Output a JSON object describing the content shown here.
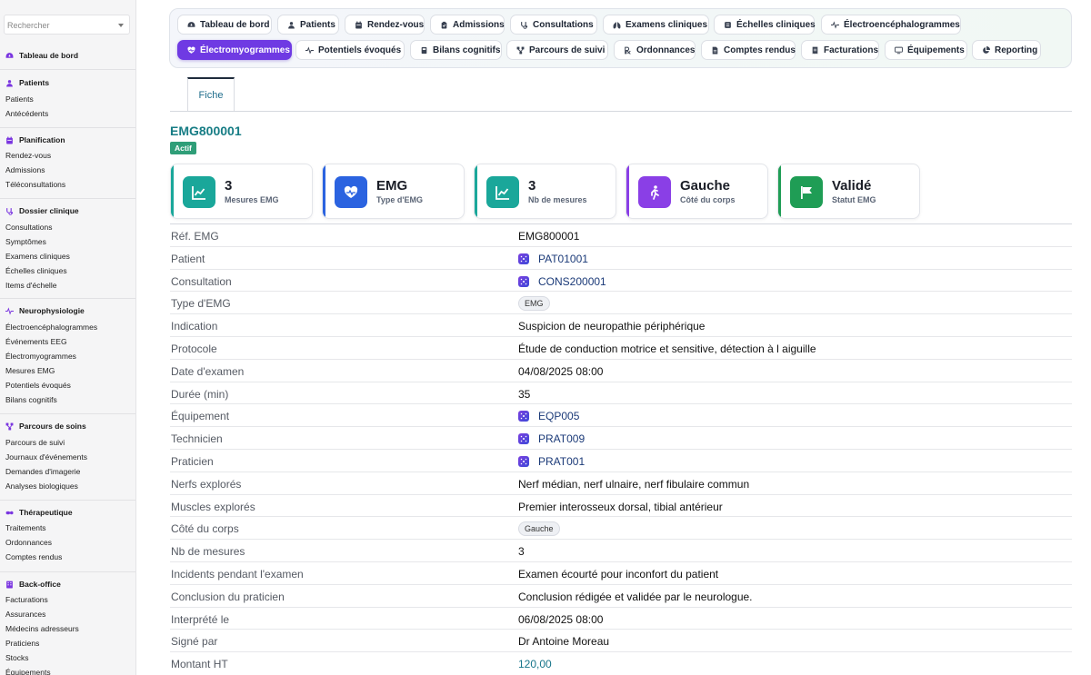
{
  "sidebar": {
    "search_placeholder": "Rechercher",
    "sections": [
      {
        "title": "Tableau de bord",
        "icon": "dashboard-icon",
        "items": []
      },
      {
        "title": "Patients",
        "icon": "user-icon",
        "items": [
          "Patients",
          "Antécédents"
        ]
      },
      {
        "title": "Planification",
        "icon": "calendar-icon",
        "items": [
          "Rendez-vous",
          "Admissions",
          "Téléconsultations"
        ]
      },
      {
        "title": "Dossier clinique",
        "icon": "stethoscope-icon",
        "items": [
          "Consultations",
          "Symptômes",
          "Examens cliniques",
          "Échelles cliniques",
          "Items d'échelle"
        ]
      },
      {
        "title": "Neurophysiologie",
        "icon": "waveform-icon",
        "items": [
          "Électroencéphalogrammes",
          "Événements EEG",
          "Électromyogrammes",
          "Mesures EMG",
          "Potentiels évoqués",
          "Bilans cognitifs"
        ]
      },
      {
        "title": "Parcours de soins",
        "icon": "route-icon",
        "items": [
          "Parcours de suivi",
          "Journaux d'événements",
          "Demandes d'imagerie",
          "Analyses biologiques"
        ]
      },
      {
        "title": "Thérapeutique",
        "icon": "pills-icon",
        "items": [
          "Traitements",
          "Ordonnances",
          "Comptes rendus"
        ]
      },
      {
        "title": "Back-office",
        "icon": "building-icon",
        "items": [
          "Facturations",
          "Assurances",
          "Médecins adresseurs",
          "Praticiens",
          "Stocks",
          "Équipements"
        ]
      }
    ]
  },
  "tabs_row1": [
    {
      "label": "Tableau de bord",
      "icon": "dashboard-icon"
    },
    {
      "label": "Patients",
      "icon": "user-icon"
    },
    {
      "label": "Rendez-vous",
      "icon": "calendar-icon"
    },
    {
      "label": "Admissions",
      "icon": "clipboard-icon"
    },
    {
      "label": "Consultations",
      "icon": "stethoscope-icon"
    },
    {
      "label": "Examens cliniques",
      "icon": "lungs-icon"
    },
    {
      "label": "Échelles cliniques",
      "icon": "scale-icon"
    },
    {
      "label": "Électroencéphalogrammes",
      "icon": "waveform-icon"
    }
  ],
  "tabs_row2": [
    {
      "label": "Électromyogrammes",
      "icon": "heart-pulse-icon",
      "active": true
    },
    {
      "label": "Potentiels évoqués",
      "icon": "waveform-icon"
    },
    {
      "label": "Bilans cognitifs",
      "icon": "book-icon"
    },
    {
      "label": "Parcours de suivi",
      "icon": "route-icon"
    },
    {
      "label": "Ordonnances",
      "icon": "prescription-icon"
    },
    {
      "label": "Comptes rendus",
      "icon": "file-icon"
    },
    {
      "label": "Facturations",
      "icon": "invoice-icon"
    },
    {
      "label": "Équipements",
      "icon": "monitor-icon"
    },
    {
      "label": "Reporting",
      "icon": "pie-chart-icon"
    }
  ],
  "detail_tab": "Fiche",
  "record": {
    "id": "EMG800001",
    "status": "Actif"
  },
  "cards": [
    {
      "value": "3",
      "label": "Mesures EMG",
      "icon": "chart-icon",
      "color": "#1aa79a"
    },
    {
      "value": "EMG",
      "label": "Type d'EMG",
      "icon": "heart-pulse-icon",
      "color": "#2b63e0"
    },
    {
      "value": "3",
      "label": "Nb de mesures",
      "icon": "chart-icon",
      "color": "#1aa79a"
    },
    {
      "value": "Gauche",
      "label": "Côté du corps",
      "icon": "walking-icon",
      "color": "#8a3fe6"
    },
    {
      "value": "Validé",
      "label": "Statut EMG",
      "icon": "flag-icon",
      "color": "#1f9d55"
    }
  ],
  "fields": [
    {
      "label": "Réf. EMG",
      "value": "EMG800001",
      "kind": "text"
    },
    {
      "label": "Patient",
      "value": "PAT01001",
      "kind": "link"
    },
    {
      "label": "Consultation",
      "value": "CONS200001",
      "kind": "link"
    },
    {
      "label": "Type d'EMG",
      "value": "EMG",
      "kind": "pill"
    },
    {
      "label": "Indication",
      "value": "Suspicion de neuropathie périphérique",
      "kind": "text"
    },
    {
      "label": "Protocole",
      "value": "Étude de conduction motrice et sensitive, détection à l aiguille",
      "kind": "text"
    },
    {
      "label": "Date d'examen",
      "value": "04/08/2025 08:00",
      "kind": "text"
    },
    {
      "label": "Durée (min)",
      "value": "35",
      "kind": "text"
    },
    {
      "label": "Équipement",
      "value": "EQP005",
      "kind": "link"
    },
    {
      "label": "Technicien",
      "value": "PRAT009",
      "kind": "link"
    },
    {
      "label": "Praticien",
      "value": "PRAT001",
      "kind": "link"
    },
    {
      "label": "Nerfs explorés",
      "value": "Nerf médian, nerf ulnaire, nerf fibulaire commun",
      "kind": "text"
    },
    {
      "label": "Muscles explorés",
      "value": "Premier interosseux dorsal, tibial antérieur",
      "kind": "text"
    },
    {
      "label": "Côté du corps",
      "value": "Gauche",
      "kind": "pill"
    },
    {
      "label": "Nb de mesures",
      "value": "3",
      "kind": "text"
    },
    {
      "label": "Incidents pendant l'examen",
      "value": "Examen écourté pour inconfort du patient",
      "kind": "text"
    },
    {
      "label": "Conclusion du praticien",
      "value": "Conclusion rédigée et validée par le neurologue.",
      "kind": "text"
    },
    {
      "label": "Interprété le",
      "value": "06/08/2025 08:00",
      "kind": "text"
    },
    {
      "label": "Signé par",
      "value": "Dr Antoine Moreau",
      "kind": "text"
    },
    {
      "label": "Montant HT",
      "value": "120,00",
      "kind": "money"
    }
  ],
  "colors": {
    "accent": "#6f3ae3",
    "teal": "#177d85",
    "success": "#2f9e78"
  }
}
